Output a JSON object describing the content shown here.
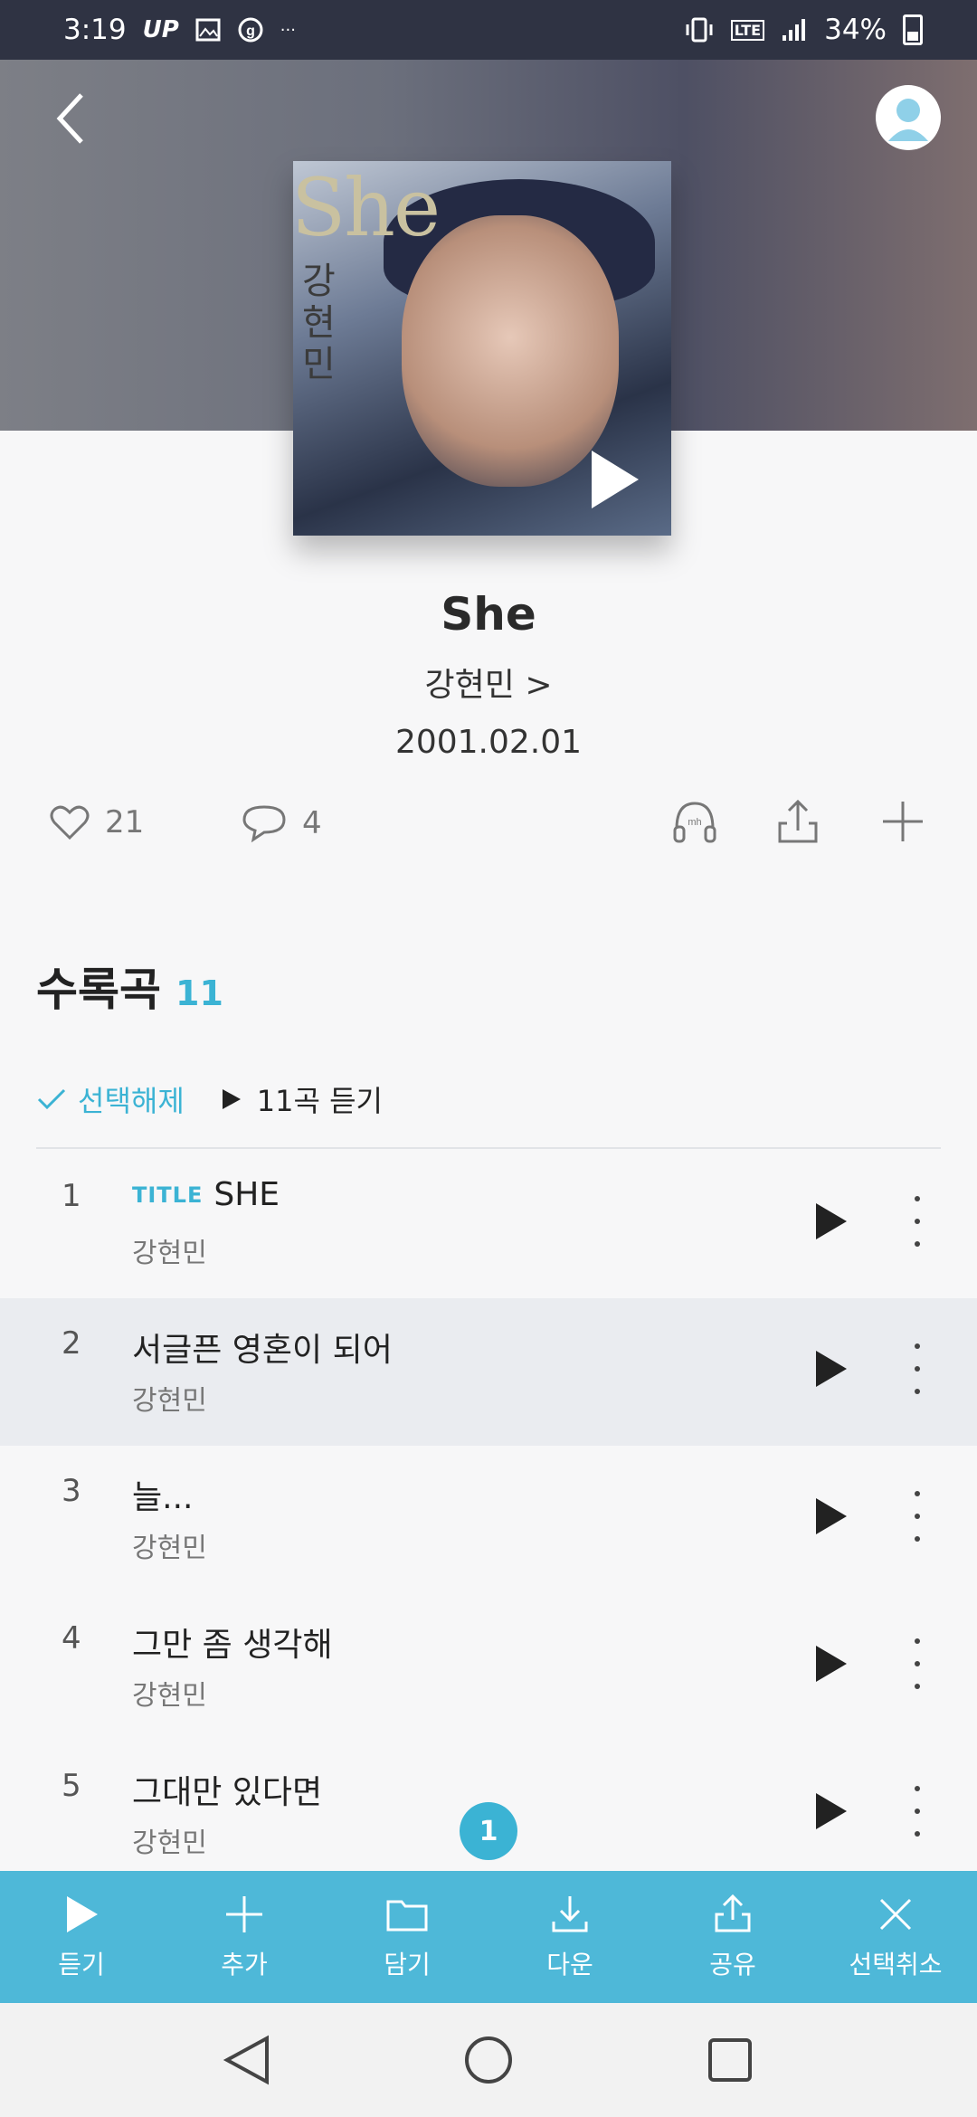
{
  "status_bar": {
    "time": "3:19",
    "indicators": [
      "UP",
      "image-icon",
      "g-icon",
      "···"
    ],
    "network": "LTE",
    "battery": "34%"
  },
  "header": {
    "back_icon": "chevron-left-icon",
    "avatar_icon": "user-avatar-icon"
  },
  "album": {
    "art_title": "She",
    "art_subtitle": "강현민",
    "title": "She",
    "artist": "강현민 >",
    "release_date": "2001.02.01"
  },
  "actions": {
    "likes": "21",
    "comments": "4"
  },
  "tracks_section": {
    "label": "수록곡",
    "count": "11",
    "deselect_label": "선택해제",
    "play_all_label": "11곡 듣기"
  },
  "tracks": [
    {
      "num": "1",
      "badge": "TITLE",
      "title": "SHE",
      "artist": "강현민"
    },
    {
      "num": "2",
      "badge": "",
      "title": "서글픈 영혼이 되어",
      "artist": "강현민"
    },
    {
      "num": "3",
      "badge": "",
      "title": "늘...",
      "artist": "강현민"
    },
    {
      "num": "4",
      "badge": "",
      "title": "그만 좀 생각해",
      "artist": "강현민"
    },
    {
      "num": "5",
      "badge": "",
      "title": "그대만 있다면",
      "artist": "강현민"
    }
  ],
  "selection_count": "1",
  "action_bar": {
    "listen": "듣기",
    "add": "추가",
    "save": "담기",
    "download": "다운",
    "share": "공유",
    "cancel": "선택취소"
  },
  "colors": {
    "accent": "#3bb3d4",
    "action_bar": "#4eb8d8",
    "status_bar": "#2f3343"
  }
}
